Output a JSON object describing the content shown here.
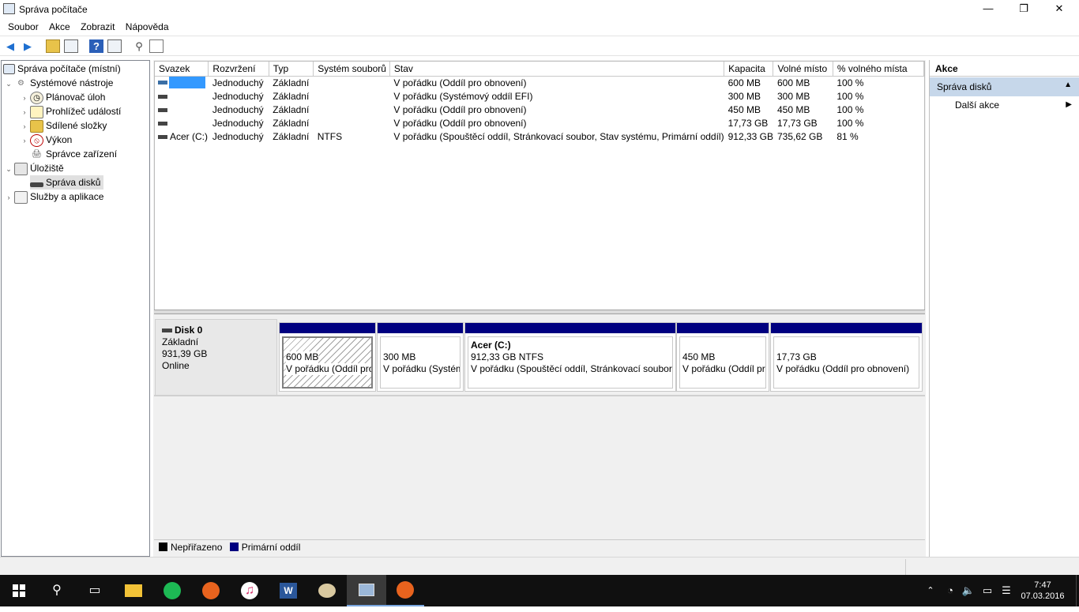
{
  "window": {
    "title": "Správa počítače",
    "min": "—",
    "max": "❐",
    "close": "✕"
  },
  "menu": [
    "Soubor",
    "Akce",
    "Zobrazit",
    "Nápověda"
  ],
  "tree": {
    "root": "Správa počítače (místní)",
    "system_tools": "Systémové nástroje",
    "task_scheduler": "Plánovač úloh",
    "event_viewer": "Prohlížeč událostí",
    "shared_folders": "Sdílené složky",
    "performance": "Výkon",
    "device_manager": "Správce zařízení",
    "storage": "Úložiště",
    "disk_management": "Správa disků",
    "services": "Služby a aplikace"
  },
  "volumes": {
    "headers": [
      "Svazek",
      "Rozvržení",
      "Typ",
      "Systém souborů",
      "Stav",
      "Kapacita",
      "Volné místo",
      "% volného místa"
    ],
    "rows": [
      [
        "",
        "Jednoduchý",
        "Základní",
        "",
        "V pořádku (Oddíl pro obnovení)",
        "600 MB",
        "600 MB",
        "100 %"
      ],
      [
        "",
        "Jednoduchý",
        "Základní",
        "",
        "V pořádku (Systémový oddíl EFI)",
        "300 MB",
        "300 MB",
        "100 %"
      ],
      [
        "",
        "Jednoduchý",
        "Základní",
        "",
        "V pořádku (Oddíl pro obnovení)",
        "450 MB",
        "450 MB",
        "100 %"
      ],
      [
        "",
        "Jednoduchý",
        "Základní",
        "",
        "V pořádku (Oddíl pro obnovení)",
        "17,73 GB",
        "17,73 GB",
        "100 %"
      ],
      [
        "Acer (C:)",
        "Jednoduchý",
        "Základní",
        "NTFS",
        "V pořádku (Spouštěcí oddíl, Stránkovací soubor, Stav systému, Primární oddíl)",
        "912,33 GB",
        "735,62 GB",
        "81 %"
      ]
    ]
  },
  "disk": {
    "name": "Disk 0",
    "type": "Základní",
    "size": "931,39 GB",
    "status": "Online",
    "partitions": [
      {
        "title": "",
        "size": "600 MB",
        "status": "V pořádku (Oddíl pro obnovení)"
      },
      {
        "title": "",
        "size": "300 MB",
        "status": "V pořádku (Systémový oddíl EFI)"
      },
      {
        "title": "Acer  (C:)",
        "size": "912,33 GB NTFS",
        "status": "V pořádku (Spouštěcí oddíl, Stránkovací soubor, Stav systému, Primární oddíl)"
      },
      {
        "title": "",
        "size": "450 MB",
        "status": "V pořádku (Oddíl pro obnovení)"
      },
      {
        "title": "",
        "size": "17,73 GB",
        "status": "V pořádku (Oddíl pro obnovení)"
      }
    ]
  },
  "legend": {
    "unallocated": "Nepřiřazeno",
    "primary": "Primární oddíl"
  },
  "actions": {
    "header": "Akce",
    "section": "Správa disků",
    "more": "Další akce"
  },
  "taskbar": {
    "time": "7:47",
    "date": "07.03.2016"
  },
  "colors": {
    "primary_partition": "#000080",
    "unallocated": "#000000",
    "selection": "#3399ff",
    "taskbar": "#101010"
  }
}
